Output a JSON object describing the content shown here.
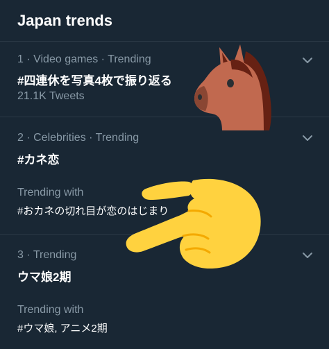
{
  "header": {
    "title": "Japan trends"
  },
  "trends": [
    {
      "meta": "1 · Video games · Trending",
      "name": "#四連休を写真4枚で振り返る",
      "tweets": "21.1K Tweets"
    },
    {
      "meta": "2 · Celebrities · Trending",
      "name": "#カネ恋",
      "with_label": "Trending with",
      "with_value": "#おカネの切れ目が恋のはじまり"
    },
    {
      "meta": "3 · Trending",
      "name": "ウマ娘2期",
      "with_label": "Trending with",
      "with_value": "#ウマ娘, アニメ2期"
    }
  ],
  "icons": {
    "chevron": "chevron-down-icon",
    "horse": "horse-face-emoji",
    "hand": "pointing-hand-emoji"
  },
  "colors": {
    "background": "#15202b",
    "secondary_text": "#8899a6",
    "primary_text": "#ffffff",
    "hand": "#ffd23f",
    "horse": "#c1694f"
  }
}
